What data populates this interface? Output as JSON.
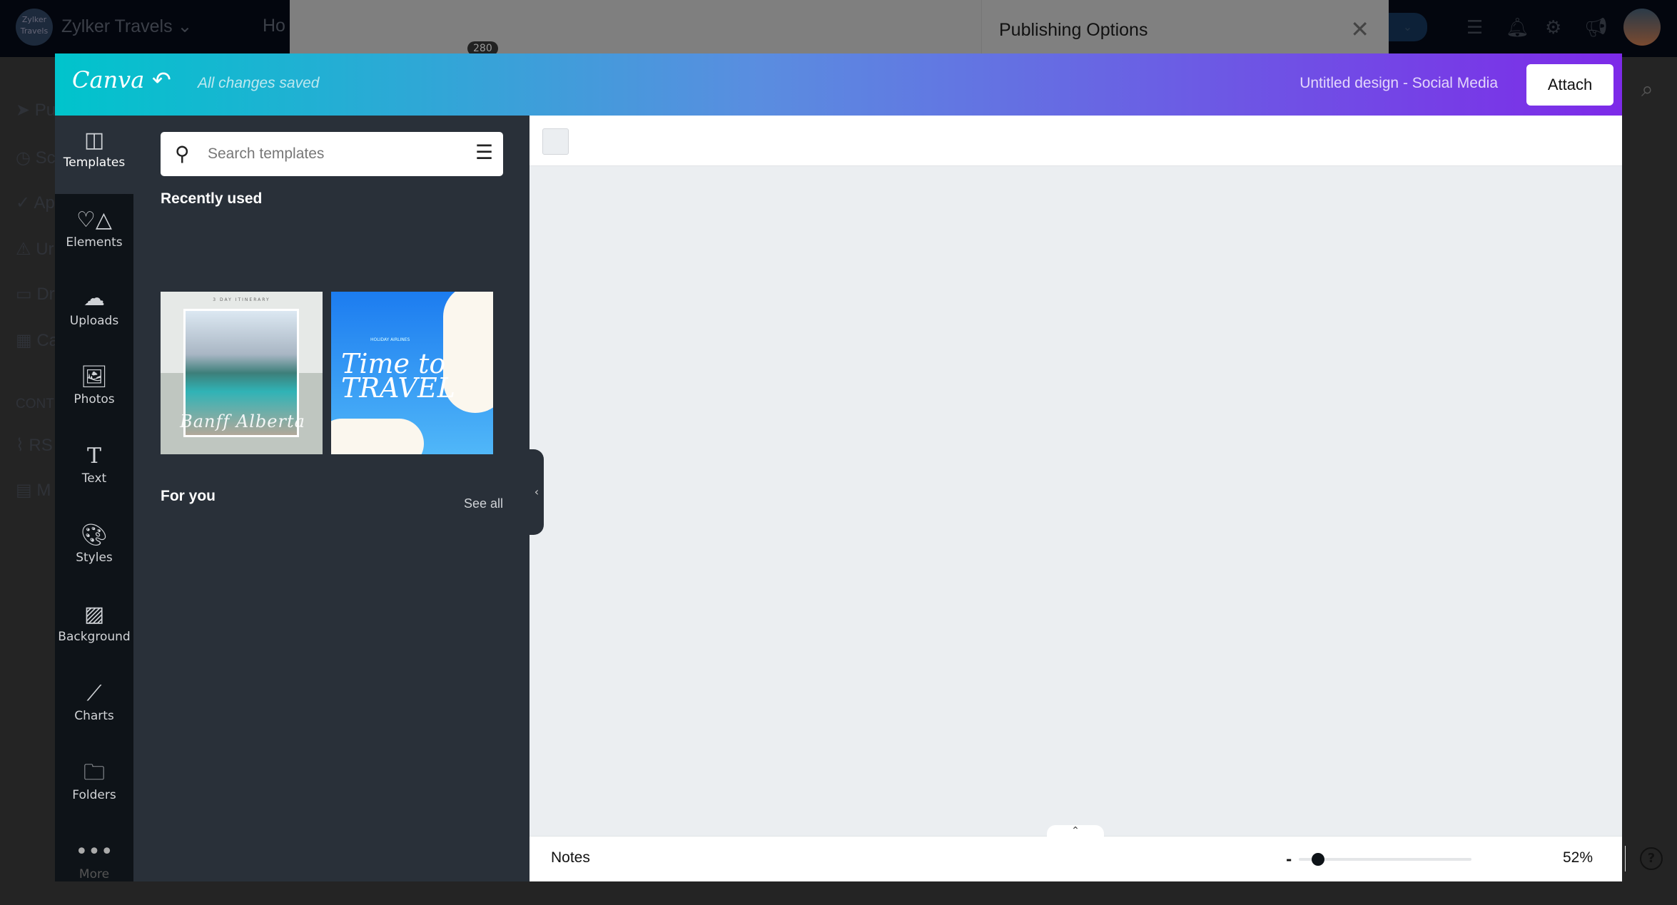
{
  "background_app": {
    "brand": "Zylker Travels",
    "brand_logo_text": "Zylker Travels",
    "nav_partial": "Ho",
    "notification_badge": "280",
    "sidebar_partial": [
      "Pu",
      "Sc",
      "Ap",
      "Ur",
      "Dr",
      "Ca",
      "CONT",
      "RS",
      "M"
    ]
  },
  "publishing_panel": {
    "title": "Publishing Options"
  },
  "canva": {
    "logo": "Canva",
    "save_status": "All changes saved",
    "design_title": "Untitled design - Social Media",
    "attach_label": "Attach",
    "brand_gradient": [
      "#00c4cc",
      "#7d2ae8"
    ],
    "rail": [
      {
        "label": "Templates",
        "icon": "templates-icon"
      },
      {
        "label": "Elements",
        "icon": "elements-icon"
      },
      {
        "label": "Uploads",
        "icon": "upload-cloud-icon"
      },
      {
        "label": "Photos",
        "icon": "photo-icon"
      },
      {
        "label": "Text",
        "icon": "text-icon"
      },
      {
        "label": "Styles",
        "icon": "palette-icon"
      },
      {
        "label": "Background",
        "icon": "background-icon"
      },
      {
        "label": "Charts",
        "icon": "chart-icon"
      },
      {
        "label": "Folders",
        "icon": "folder-icon"
      },
      {
        "label": "More",
        "icon": "more-icon"
      }
    ],
    "panel": {
      "search_placeholder": "Search templates",
      "recently_used": "Recently used",
      "templates": [
        {
          "caption": "3 DAY ITINERARY",
          "script": "Banff Alberta"
        },
        {
          "caption": "HOLIDAY AIRLINES",
          "script": "Time to TRAVEL"
        }
      ],
      "for_you": "For you",
      "see_all": "See all"
    },
    "footer": {
      "notes": "Notes",
      "zoom": "52%",
      "zoom_percent": 52
    }
  }
}
